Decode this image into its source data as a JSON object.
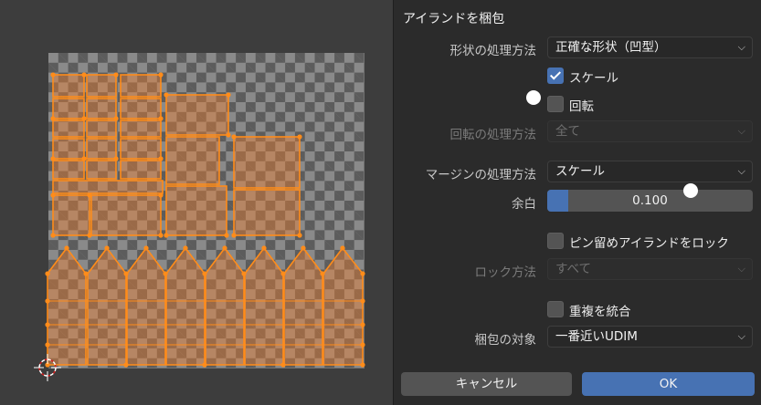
{
  "viewport": {
    "label": "UV Editor"
  },
  "dialog": {
    "title": "アイランドを梱包",
    "shape_method_label": "形状の処理方法",
    "shape_method_value": "正確な形状（凹型）",
    "scale_label": "スケール",
    "scale_checked": true,
    "rotate_label": "回転",
    "rotate_checked": false,
    "rotate_method_label": "回転の処理方法",
    "rotate_method_value": "全て",
    "margin_method_label": "マージンの処理方法",
    "margin_method_value": "スケール",
    "margin_label": "余白",
    "margin_value": "0.100",
    "margin_fraction": 0.1,
    "lock_pinned_label": "ピン留めアイランドをロック",
    "lock_pinned_checked": false,
    "lock_method_label": "ロック方法",
    "lock_method_value": "すべて",
    "merge_overlap_label": "重複を統合",
    "merge_overlap_checked": false,
    "pack_to_label": "梱包の対象",
    "pack_to_value": "一番近いUDIM",
    "cancel_label": "キャンセル",
    "ok_label": "OK"
  },
  "colors": {
    "accent": "#4772b3",
    "uv_orange": "#ff8c1a",
    "panel_bg": "#2b2b2b"
  },
  "icons": {
    "dropdown": "chevron-down-icon",
    "cursor": "3d-cursor-icon"
  }
}
